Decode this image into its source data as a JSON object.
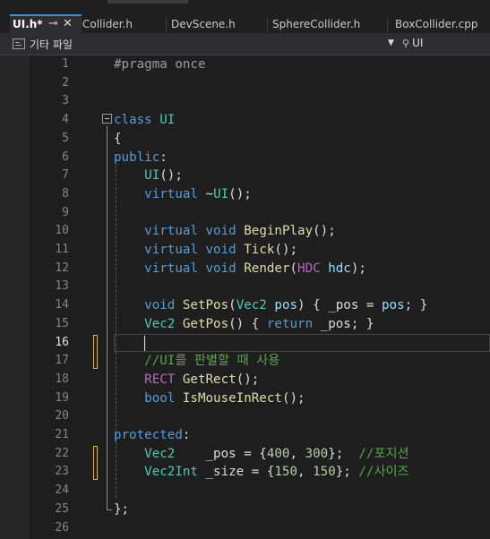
{
  "tabs": [
    {
      "label": "UI.h*",
      "active": true
    },
    {
      "label": "Collider.h",
      "active": false
    },
    {
      "label": "DevScene.h",
      "active": false
    },
    {
      "label": "SphereCollider.h",
      "active": false
    },
    {
      "label": "BoxCollider.cpp",
      "active": false
    }
  ],
  "tab_icons": {
    "pin": "pin-icon",
    "close": "close-icon"
  },
  "navbar": {
    "project": "기타 파일",
    "dropdown_arrow": "chevron-down-icon",
    "scope_icon": "class-scope-icon",
    "scope": "UI"
  },
  "editor": {
    "current_line": 16,
    "colors": {
      "keyword": "#569cd6",
      "type": "#4ec9b0",
      "function": "#dcdcaa",
      "comment": "#57a64a",
      "number": "#b5cea8",
      "macro": "#bd63c5",
      "parameter": "#9cdcfe",
      "change_marker": "#d7ba4a"
    },
    "lines": [
      {
        "n": "1",
        "text": "#pragma once"
      },
      {
        "n": "2",
        "text": ""
      },
      {
        "n": "3",
        "text": ""
      },
      {
        "n": "4",
        "text": "class UI"
      },
      {
        "n": "5",
        "text": "{"
      },
      {
        "n": "6",
        "text": "public:"
      },
      {
        "n": "7",
        "text": "    UI();"
      },
      {
        "n": "8",
        "text": "    virtual ~UI();"
      },
      {
        "n": "9",
        "text": ""
      },
      {
        "n": "10",
        "text": "    virtual void BeginPlay();"
      },
      {
        "n": "11",
        "text": "    virtual void Tick();"
      },
      {
        "n": "12",
        "text": "    virtual void Render(HDC hdc);"
      },
      {
        "n": "13",
        "text": ""
      },
      {
        "n": "14",
        "text": "    void SetPos(Vec2 pos) { _pos = pos; }"
      },
      {
        "n": "15",
        "text": "    Vec2 GetPos() { return _pos; }"
      },
      {
        "n": "16",
        "text": "    "
      },
      {
        "n": "17",
        "text": "    //UI를 판별할 때 사용"
      },
      {
        "n": "18",
        "text": "    RECT GetRect();"
      },
      {
        "n": "19",
        "text": "    bool IsMouseInRect();"
      },
      {
        "n": "20",
        "text": ""
      },
      {
        "n": "21",
        "text": "protected:"
      },
      {
        "n": "22",
        "text": "    Vec2    _pos = {400, 300};  //포지션"
      },
      {
        "n": "23",
        "text": "    Vec2Int _size = {150, 150}; //사이즈"
      },
      {
        "n": "24",
        "text": ""
      },
      {
        "n": "25",
        "text": "};"
      },
      {
        "n": "26",
        "text": ""
      }
    ]
  }
}
